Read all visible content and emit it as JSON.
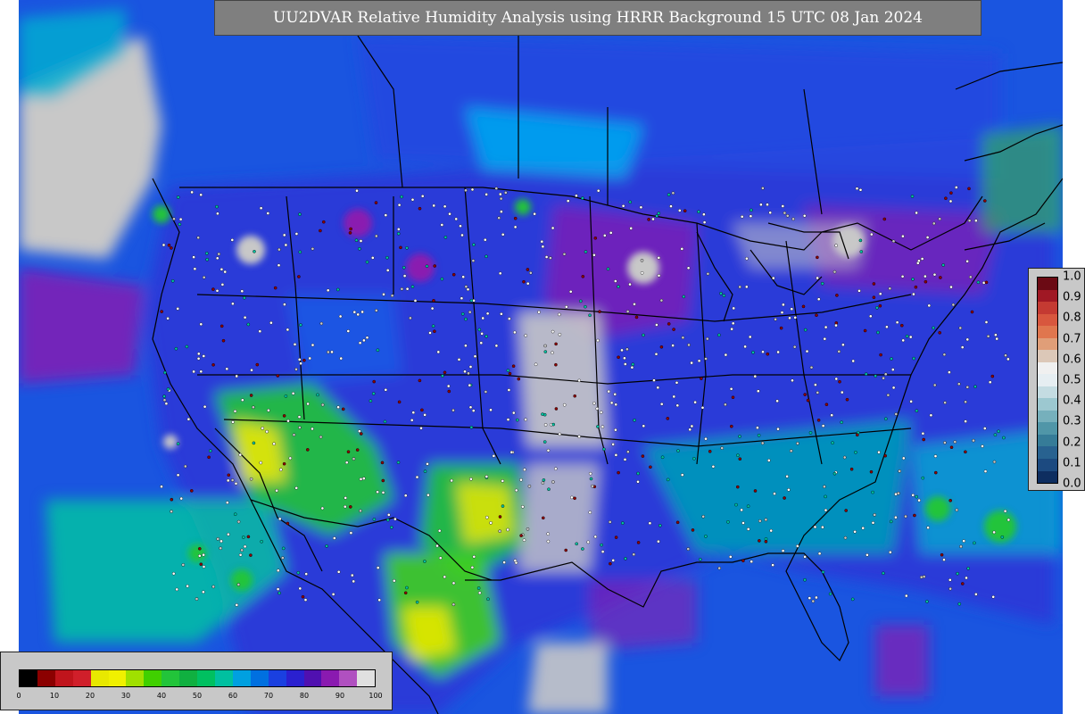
{
  "title": "UU2DVAR Relative Humidity Analysis using HRRR Background 15 UTC 08 Jan 2024",
  "colors": {
    "ocean_blue": "#1a55e0",
    "land_background": "#2a3ad8",
    "dry_green": "#22c43a",
    "very_dry_yellow": "#e8e800",
    "moist_purple": "#8a1ab0",
    "saturated_gray": "#c8c8c8",
    "border_line": "#000000",
    "station_marker": "#ffffff"
  },
  "rh_colorbar": {
    "unit_hint": "relative humidity (%)",
    "ticks": [
      "0",
      "10",
      "20",
      "30",
      "40",
      "50",
      "60",
      "70",
      "80",
      "90",
      "100"
    ],
    "colors": [
      "#000000",
      "#8b0000",
      "#c0141c",
      "#d01f2a",
      "#e8e800",
      "#f0f000",
      "#a0e000",
      "#40d000",
      "#22c43a",
      "#10b040",
      "#00c060",
      "#00c0a0",
      "#00a0e0",
      "#0070e0",
      "#1a40e0",
      "#2a20d0",
      "#5010b0",
      "#8a1ab0",
      "#b050c0",
      "#e0e0e0"
    ]
  },
  "error_colorbar": {
    "ticks": [
      "1.0",
      "0.9",
      "0.8",
      "0.7",
      "0.6",
      "0.5",
      "0.4",
      "0.3",
      "0.2",
      "0.1",
      "0.0"
    ],
    "colors": [
      "#6b0a14",
      "#a01824",
      "#c43a32",
      "#d8573e",
      "#e0764e",
      "#e09e78",
      "#dcc8b8",
      "#f0f0f0",
      "#e6eef2",
      "#c4dce2",
      "#9cc8d0",
      "#76b0bc",
      "#5096a8",
      "#367c98",
      "#286290",
      "#1c4a80",
      "#0e2e60"
    ]
  }
}
